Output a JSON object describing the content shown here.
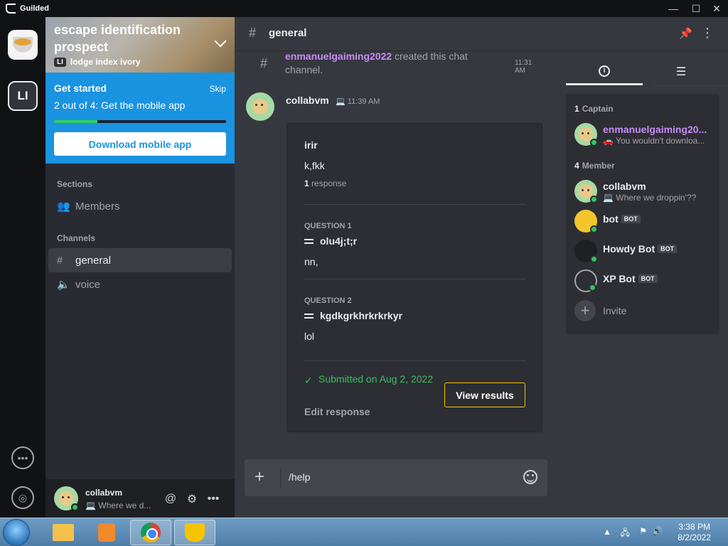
{
  "app": {
    "title": "Guilded"
  },
  "window_controls": {
    "minimize": "—",
    "maximize": "☐",
    "close": "✕"
  },
  "server": {
    "name": "escape identification prospect",
    "initials": "LI",
    "subtitle": "lodge index ivory"
  },
  "get_started": {
    "title": "Get started",
    "skip": "Skip",
    "step": "2 out of 4: Get the mobile app",
    "progress": 0.25,
    "button": "Download mobile app"
  },
  "sections": {
    "label": "Sections",
    "items": [
      {
        "label": "Members",
        "icon": "members-icon"
      }
    ]
  },
  "channels": {
    "label": "Channels",
    "items": [
      {
        "label": "general",
        "icon": "hash-icon",
        "active": true
      },
      {
        "label": "voice",
        "icon": "speaker-icon",
        "active": false
      }
    ]
  },
  "user_bar": {
    "name": "collabvm",
    "status": "Where we d..."
  },
  "topbar": {
    "channel": "general"
  },
  "system_message": {
    "user": "enmanuelgaiming2022",
    "text": " created this chat channel.",
    "time": "11:31 AM"
  },
  "message": {
    "author": "collabvm",
    "time": "11:39 AM",
    "form": {
      "title": "irir",
      "description": "k,fkk",
      "response_count": "1",
      "response_label": " response",
      "questions": [
        {
          "label": "QUESTION 1",
          "question": "olu4j;t;r",
          "answer": "nn,"
        },
        {
          "label": "QUESTION 2",
          "question": "kgdkgrkhrkrkrkyr",
          "answer": "lol"
        }
      ],
      "submitted": "Submitted on Aug 2, 2022",
      "edit": "Edit response",
      "view": "View results"
    }
  },
  "composer": {
    "value": "/help"
  },
  "members_panel": {
    "groups": [
      {
        "count": "1",
        "label": "Captain",
        "members": [
          {
            "name": "enmanuelgaiming20...",
            "status": "🚗 You wouldn't downloa..."
          }
        ]
      },
      {
        "count": "4",
        "label": "Member",
        "members": [
          {
            "name": "collabvm",
            "status": "💻 Where we droppin'??"
          },
          {
            "name": "bot",
            "badge": "BOT"
          },
          {
            "name": "Howdy Bot",
            "badge": "BOT"
          },
          {
            "name": "XP Bot",
            "badge": "BOT"
          }
        ]
      }
    ],
    "invite": "Invite"
  },
  "taskbar": {
    "time": "3:38 PM",
    "date": "8/2/2022"
  }
}
